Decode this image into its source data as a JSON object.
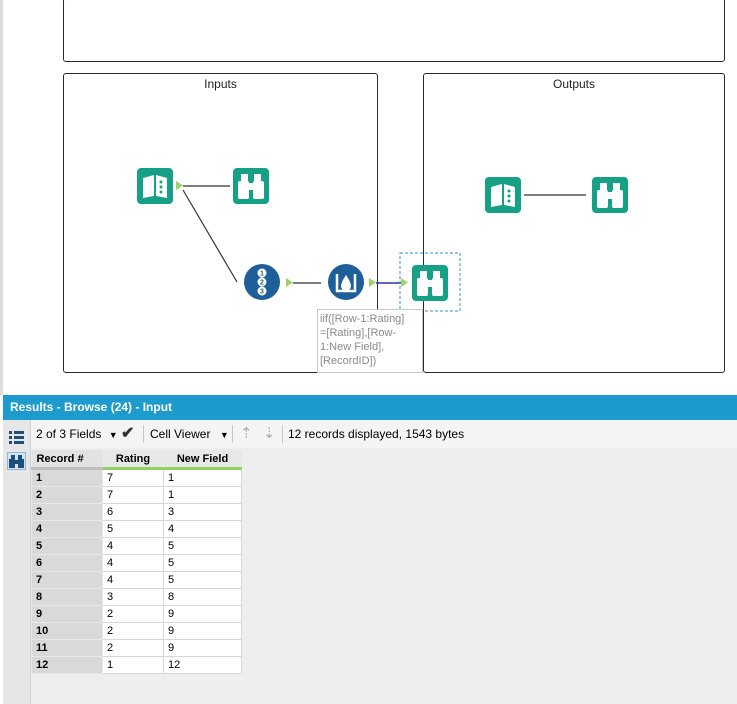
{
  "canvas": {
    "containers": [
      {
        "title": ""
      },
      {
        "title": "Inputs"
      },
      {
        "title": "Outputs"
      }
    ],
    "tooltip_lines": [
      "iif([Row-1:Rating]",
      "=[Rating],[Row-",
      "1:New Field],",
      "[RecordID])"
    ],
    "colors": {
      "tool_teal": "#16a085",
      "tool_blue": "#1f5f99",
      "anchor_green": "#9bd36b",
      "selection_blue": "#3a8fd0"
    }
  },
  "results": {
    "title": "Results - Browse (24) - Input",
    "toolbar": {
      "fields_label": "2 of 3 Fields",
      "viewer_label": "Cell Viewer",
      "status": "12 records displayed, 1543 bytes"
    },
    "columns": [
      "Record #",
      "Rating",
      "New Field"
    ],
    "rows": [
      [
        "1",
        "7",
        "1"
      ],
      [
        "2",
        "7",
        "1"
      ],
      [
        "3",
        "6",
        "3"
      ],
      [
        "4",
        "5",
        "4"
      ],
      [
        "5",
        "4",
        "5"
      ],
      [
        "6",
        "4",
        "5"
      ],
      [
        "7",
        "4",
        "5"
      ],
      [
        "8",
        "3",
        "8"
      ],
      [
        "9",
        "2",
        "9"
      ],
      [
        "10",
        "2",
        "9"
      ],
      [
        "11",
        "2",
        "9"
      ],
      [
        "12",
        "1",
        "12"
      ]
    ]
  }
}
